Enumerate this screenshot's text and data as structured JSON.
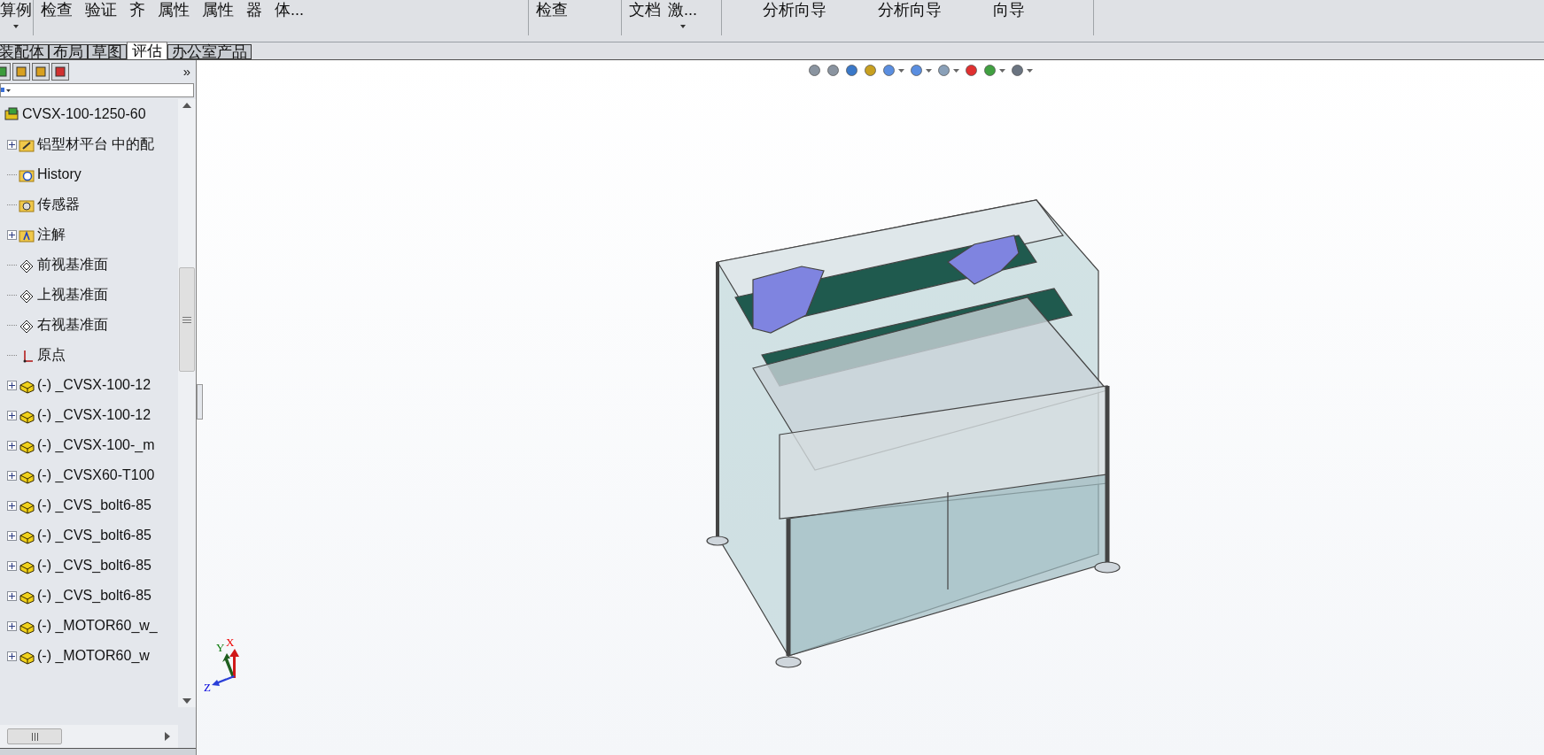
{
  "toolbar": {
    "groups": [
      {
        "items": [
          {
            "label": "算例",
            "dropdown": true
          }
        ]
      },
      {
        "items": [
          {
            "label": "检查",
            "dropdown": false
          },
          {
            "label": "验证",
            "dropdown": false
          },
          {
            "label": "齐",
            "dropdown": false
          },
          {
            "label": "属性",
            "dropdown": false
          },
          {
            "label": "属性",
            "dropdown": false
          },
          {
            "label": "器",
            "dropdown": false
          },
          {
            "label": "体...",
            "dropdown": false
          }
        ]
      },
      {
        "items": [
          {
            "label": "检查",
            "dropdown": false
          }
        ]
      },
      {
        "items": [
          {
            "label": "文档",
            "dropdown": false
          },
          {
            "label": "激...",
            "dropdown": true
          }
        ]
      },
      {
        "items": [
          {
            "label": "分析向导",
            "dropdown": false
          },
          {
            "label": "分析向导",
            "dropdown": false
          },
          {
            "label": "向导",
            "dropdown": false
          }
        ]
      }
    ]
  },
  "tabs": [
    {
      "label": "装配体",
      "selected": false
    },
    {
      "label": "布局",
      "selected": false
    },
    {
      "label": "草图",
      "selected": false
    },
    {
      "label": "评估",
      "selected": true
    },
    {
      "label": "办公室产品",
      "selected": false
    }
  ],
  "panel": {
    "more": "»",
    "tree": [
      {
        "label": "CVSX-100-1250-60",
        "kind": "assembly",
        "children": [
          {
            "label": "铝型材平台 中的配",
            "kind": "mates",
            "expander": true
          },
          {
            "label": "History",
            "kind": "history",
            "expander": false
          },
          {
            "label": "传感器",
            "kind": "sensor",
            "expander": false
          },
          {
            "label": "注解",
            "kind": "annotation",
            "expander": true
          },
          {
            "label": "前视基准面",
            "kind": "plane",
            "expander": false
          },
          {
            "label": "上视基准面",
            "kind": "plane",
            "expander": false
          },
          {
            "label": "右视基准面",
            "kind": "plane",
            "expander": false
          },
          {
            "label": "原点",
            "kind": "origin",
            "expander": false
          },
          {
            "label": "(-) _CVSX-100-12",
            "kind": "part",
            "expander": true
          },
          {
            "label": "(-) _CVSX-100-12",
            "kind": "part",
            "expander": true
          },
          {
            "label": "(-) _CVSX-100-_m",
            "kind": "part",
            "expander": true
          },
          {
            "label": "(-) _CVSX60-T100",
            "kind": "part",
            "expander": true
          },
          {
            "label": "(-) _CVS_bolt6-85",
            "kind": "part",
            "expander": true
          },
          {
            "label": "(-) _CVS_bolt6-85",
            "kind": "part",
            "expander": true
          },
          {
            "label": "(-) _CVS_bolt6-85",
            "kind": "part",
            "expander": true
          },
          {
            "label": "(-) _CVS_bolt6-85",
            "kind": "part",
            "expander": true
          },
          {
            "label": "(-) _MOTOR60_w_",
            "kind": "part",
            "expander": true
          },
          {
            "label": "(-) _MOTOR60_w",
            "kind": "part",
            "expander": true
          }
        ]
      }
    ]
  },
  "triad": {
    "x": "X",
    "y": "Y",
    "z": "Z"
  }
}
